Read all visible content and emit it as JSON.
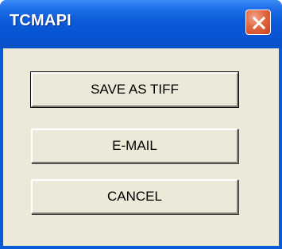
{
  "window": {
    "title": "TCMAPI"
  },
  "buttons": {
    "save_label": "SAVE AS TIFF",
    "email_label": "E-MAIL",
    "cancel_label": "CANCEL"
  },
  "icons": {
    "close": "close-icon"
  },
  "colors": {
    "titlebar": "#0b5ad9",
    "client_bg": "#ece9d8",
    "close_button": "#e2683f"
  }
}
